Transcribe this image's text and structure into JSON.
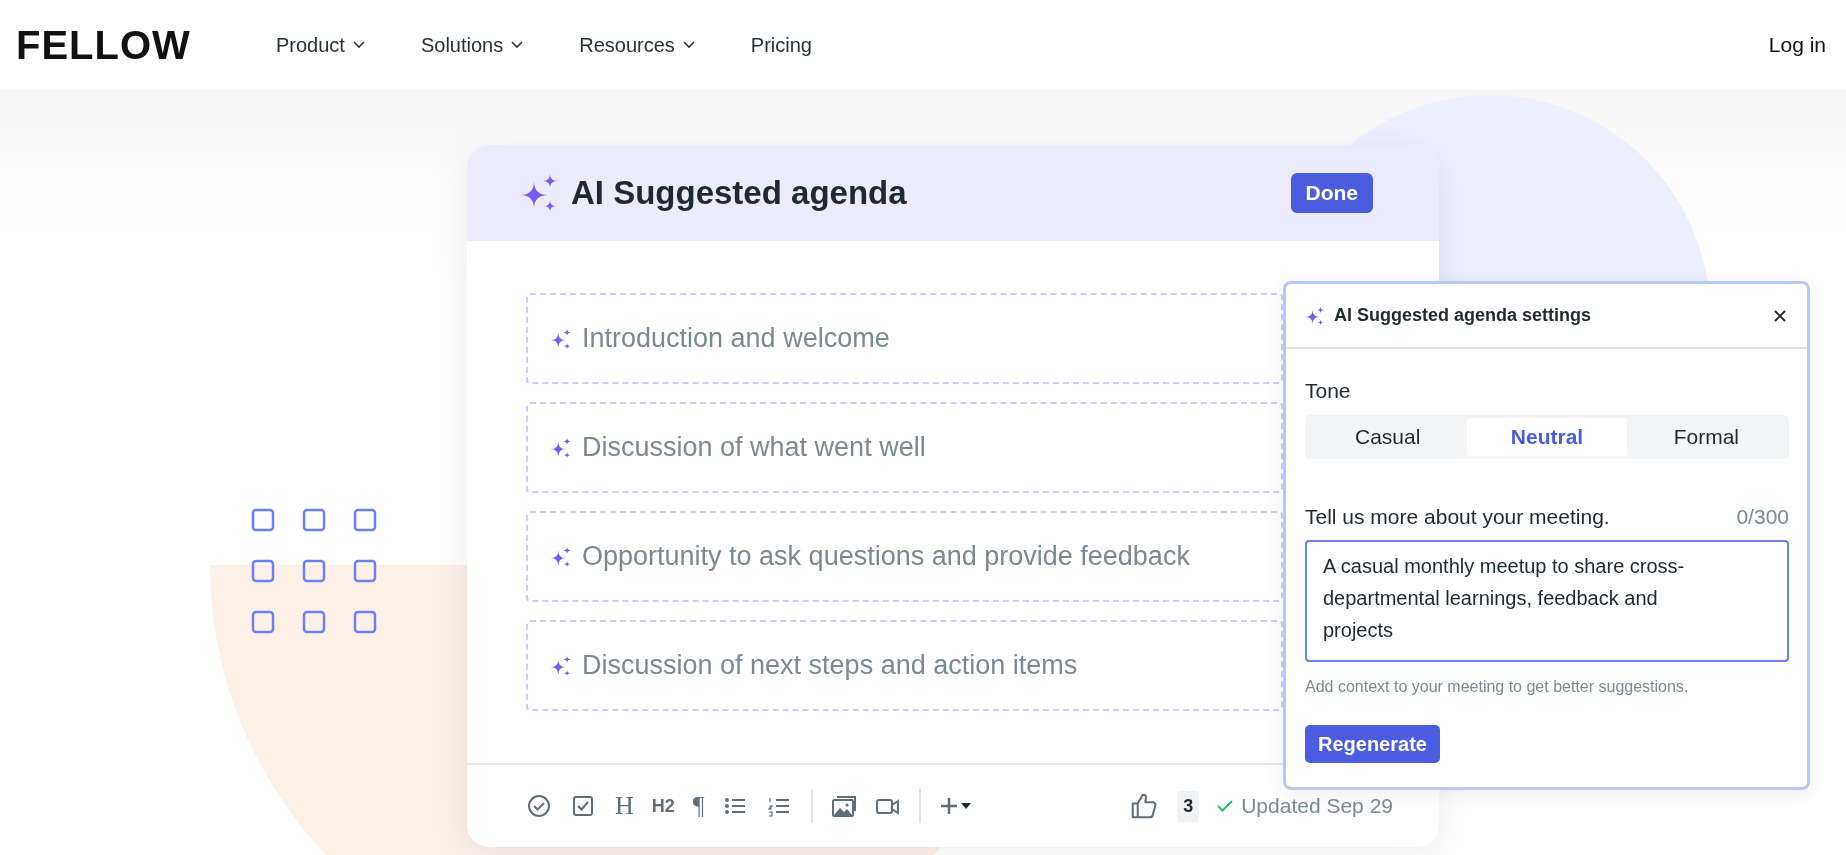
{
  "nav": {
    "logo": "FELLOW",
    "items": [
      {
        "label": "Product",
        "dropdown": true
      },
      {
        "label": "Solutions",
        "dropdown": true
      },
      {
        "label": "Resources",
        "dropdown": true
      },
      {
        "label": "Pricing",
        "dropdown": false
      }
    ],
    "login": "Log in"
  },
  "agenda": {
    "title": "AI Suggested agenda",
    "done_button": "Done",
    "items": [
      "Introduction and welcome",
      "Discussion of what went well",
      "Opportunity to ask questions and provide feedback",
      "Discussion of next steps and action items"
    ]
  },
  "toolbar": {
    "tools": [
      {
        "kind": "check-circle"
      },
      {
        "kind": "checkbox"
      },
      {
        "kind": "glyph",
        "text": "H",
        "serif": true
      },
      {
        "kind": "glyph",
        "text": "H2",
        "serif": false
      },
      {
        "kind": "glyph",
        "text": "¶",
        "serif": true
      },
      {
        "kind": "bullets"
      },
      {
        "kind": "numbered"
      },
      {
        "kind": "divider"
      },
      {
        "kind": "image"
      },
      {
        "kind": "video"
      },
      {
        "kind": "divider"
      },
      {
        "kind": "add"
      }
    ],
    "likes": "3",
    "status": "Updated Sep 29"
  },
  "settings": {
    "title": "AI Suggested agenda settings",
    "tone_label": "Tone",
    "tones": [
      {
        "label": "Casual",
        "selected": false
      },
      {
        "label": "Neutral",
        "selected": true
      },
      {
        "label": "Formal",
        "selected": false
      }
    ],
    "context_label": "Tell us more about your meeting.",
    "char_count": "0/300",
    "context_value": "A casual monthly meetup to share cross-departmental learnings, feedback and projects",
    "hint": "Add context to your meeting to get better suggestions.",
    "regenerate_button": "Regenerate"
  }
}
